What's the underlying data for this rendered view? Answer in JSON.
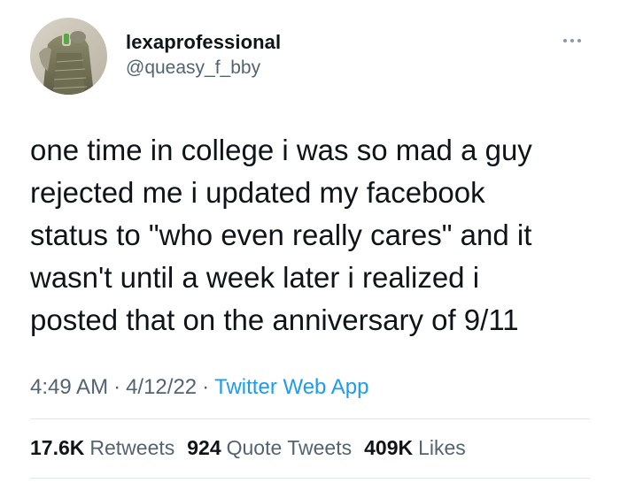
{
  "user": {
    "display_name": "lexaprofessional",
    "handle": "@queasy_f_bby"
  },
  "tweet": {
    "text": "one time in college i was so mad a guy\nrejected me i updated my facebook\nstatus to \"who even really cares\" and it\nwasn't until a week later i realized i\nposted that on the anniversary of 9/11"
  },
  "meta": {
    "time": "4:49 AM",
    "separator": "·",
    "date": "4/12/22",
    "source": "Twitter Web App"
  },
  "stats": {
    "retweets_count": "17.6K",
    "retweets_label": "Retweets",
    "quotes_count": "924",
    "quotes_label": "Quote Tweets",
    "likes_count": "409K",
    "likes_label": "Likes"
  },
  "icons": {
    "more": "more-horizontal-icon",
    "avatar": "profile-photo"
  },
  "colors": {
    "text": "#0f1419",
    "secondary": "#536471",
    "link": "#1d9bf0",
    "divider": "#e1e8ed"
  }
}
